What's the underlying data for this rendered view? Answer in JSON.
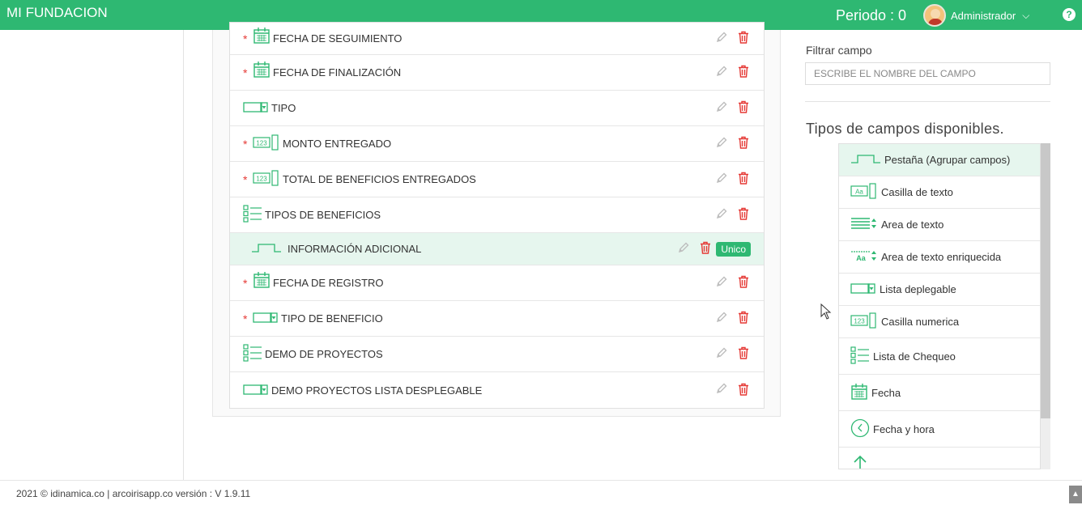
{
  "header": {
    "brand": "MI FUNDACION",
    "periodo": "Periodo : 0",
    "user_name": "Administrador",
    "help": "?"
  },
  "fields": [
    {
      "label": "FECHA DE SEGUIMIENTO",
      "icon": "calendar-icon",
      "required": true
    },
    {
      "label": "FECHA DE FINALIZACIÓN",
      "icon": "calendar-icon",
      "required": true
    },
    {
      "label": "TIPO",
      "icon": "dropdown-field-icon",
      "required": false
    },
    {
      "label": "MONTO ENTREGADO",
      "icon": "numeric-field-icon",
      "required": true
    },
    {
      "label": "TOTAL DE BENEFICIOS ENTREGADOS",
      "icon": "numeric-field-icon",
      "required": true
    },
    {
      "label": "TIPOS DE BENEFICIOS",
      "icon": "checklist-icon",
      "required": false
    },
    {
      "label": "INFORMACIÓN ADICIONAL",
      "icon": "tab-group-icon",
      "required": false,
      "badge": "Unico"
    },
    {
      "label": "FECHA DE REGISTRO",
      "icon": "calendar-icon",
      "required": true
    },
    {
      "label": "TIPO DE BENEFICIO",
      "icon": "dropdown-field-icon",
      "required": true
    },
    {
      "label": "DEMO DE PROYECTOS",
      "icon": "checklist-icon",
      "required": false
    },
    {
      "label": "DEMO PROYECTOS LISTA DESPLEGABLE",
      "icon": "dropdown-field-icon",
      "required": false
    }
  ],
  "sidebar": {
    "filter_label": "Filtrar campo",
    "filter_placeholder": "ESCRIBE EL NOMBRE DEL CAMPO",
    "types_title": "Tipos de campos disponibles.",
    "types": [
      {
        "label": "Pestaña (Agrupar campos)",
        "icon": "tab-group-icon"
      },
      {
        "label": "Casilla de texto",
        "icon": "text-field-icon"
      },
      {
        "label": "Area de texto",
        "icon": "text-area-icon"
      },
      {
        "label": "Area de texto enriquecida",
        "icon": "rich-text-icon"
      },
      {
        "label": "Lista deplegable",
        "icon": "dropdown-field-icon"
      },
      {
        "label": "Casilla numerica",
        "icon": "numeric-field-icon"
      },
      {
        "label": "Lista de Chequeo",
        "icon": "checklist-icon"
      },
      {
        "label": "Fecha",
        "icon": "calendar-icon"
      },
      {
        "label": "Fecha y hora",
        "icon": "clock-icon"
      },
      {
        "label": "",
        "icon": "upload-icon"
      }
    ]
  },
  "footer": {
    "text": "2021 © idinamica.co | arcoirisapp.co versión : V 1.9.11"
  },
  "colors": {
    "accent": "#2eb872",
    "danger": "#e53935",
    "highlight": "#e6f6ee"
  }
}
